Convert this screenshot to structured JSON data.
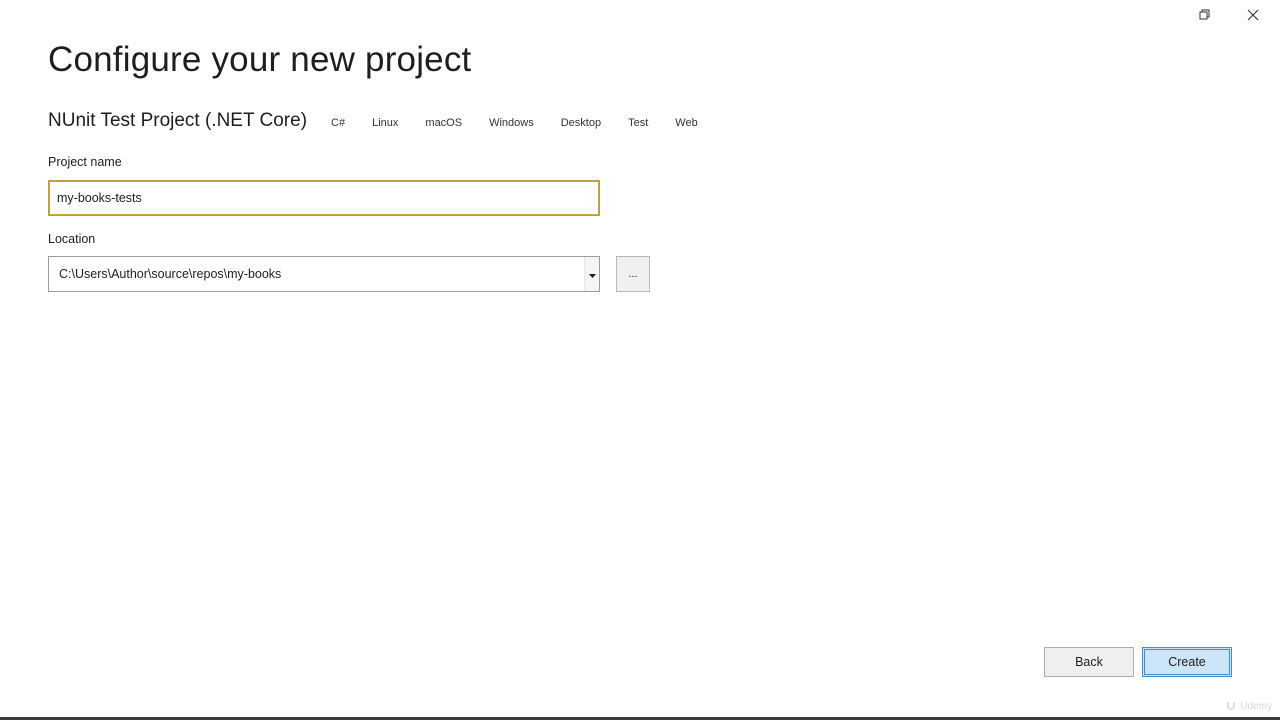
{
  "window": {
    "controls": {
      "restore_icon": "restore-icon",
      "close_icon": "close-icon"
    }
  },
  "page": {
    "title": "Configure your new project"
  },
  "template": {
    "name": "NUnit Test Project (.NET Core)",
    "tags": [
      "C#",
      "Linux",
      "macOS",
      "Windows",
      "Desktop",
      "Test",
      "Web"
    ]
  },
  "project_name": {
    "label": "Project name",
    "value": "my-books-tests"
  },
  "location": {
    "label": "Location",
    "value": "C:\\Users\\Author\\source\\repos\\my-books",
    "browse_label": "..."
  },
  "footer": {
    "back_label": "Back",
    "create_label": "Create"
  },
  "watermark": {
    "text": "Udemy"
  },
  "colors": {
    "focus_border": "#c9a63c",
    "primary_button_bg": "#cce4f7",
    "primary_button_border": "#3d8fd6"
  }
}
